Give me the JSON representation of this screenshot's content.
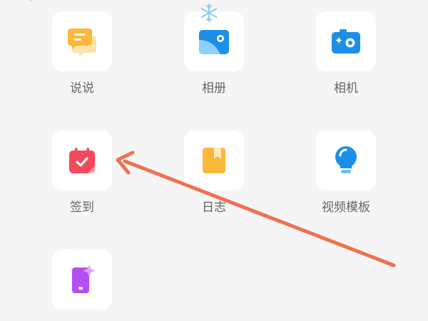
{
  "apps": [
    {
      "id": "shuoshuo",
      "label": "说说",
      "icon": "speech-bubble-icon"
    },
    {
      "id": "album",
      "label": "相册",
      "icon": "photo-album-icon"
    },
    {
      "id": "camera",
      "label": "相机",
      "icon": "camera-icon"
    },
    {
      "id": "checkin",
      "label": "签到",
      "icon": "calendar-check-icon"
    },
    {
      "id": "diary",
      "label": "日志",
      "icon": "diary-book-icon"
    },
    {
      "id": "video-template",
      "label": "视频模板",
      "icon": "lightbulb-icon"
    },
    {
      "id": "extra",
      "label": "",
      "icon": "sparkle-phone-icon"
    }
  ],
  "colors": {
    "background": "#f5f5f5",
    "tile": "#ffffff",
    "label": "#666666",
    "annotation_arrow": "#f07050"
  }
}
